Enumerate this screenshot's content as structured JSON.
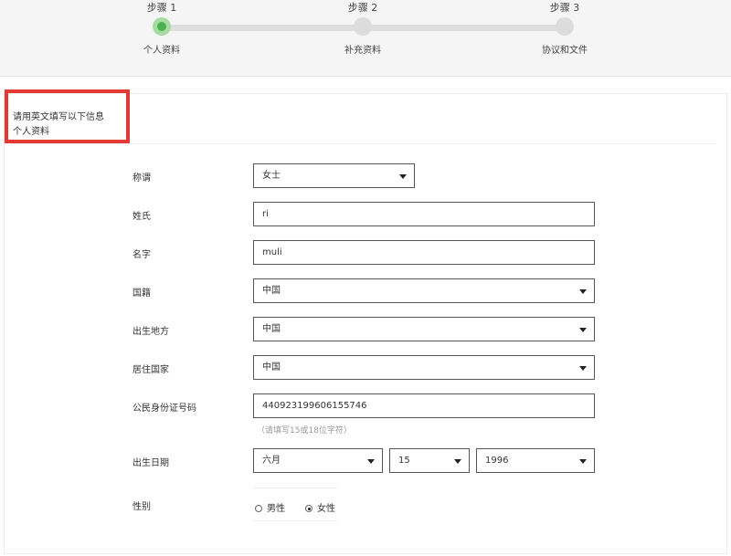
{
  "steps": [
    {
      "title": "步骤 1",
      "label": "个人资料",
      "active": true
    },
    {
      "title": "步骤 2",
      "label": "补充资料",
      "active": false
    },
    {
      "title": "步骤 3",
      "label": "协议和文件",
      "active": false
    }
  ],
  "intro": {
    "line1": "请用英文填写以下信息",
    "line2": "个人资料"
  },
  "form": {
    "salutation": {
      "label": "称谓",
      "value": "女士"
    },
    "surname": {
      "label": "姓氏",
      "value": "ri"
    },
    "given_name": {
      "label": "名字",
      "value": "muli"
    },
    "nationality": {
      "label": "国籍",
      "value": "中国"
    },
    "birthplace": {
      "label": "出生地方",
      "value": "中国"
    },
    "residence_country": {
      "label": "居住国家",
      "value": "中国"
    },
    "id_number": {
      "label": "公民身份证号码",
      "value": "440923199606155746",
      "hint": "（请填写15或18位字符）"
    },
    "birth_date": {
      "label": "出生日期",
      "month": "六月",
      "day": "15",
      "year": "1996"
    },
    "gender": {
      "label": "性别",
      "options": [
        "男性",
        "女性"
      ],
      "selected": "女性"
    }
  },
  "colors": {
    "highlight": "#e53935",
    "active_step": "#4caf50"
  }
}
